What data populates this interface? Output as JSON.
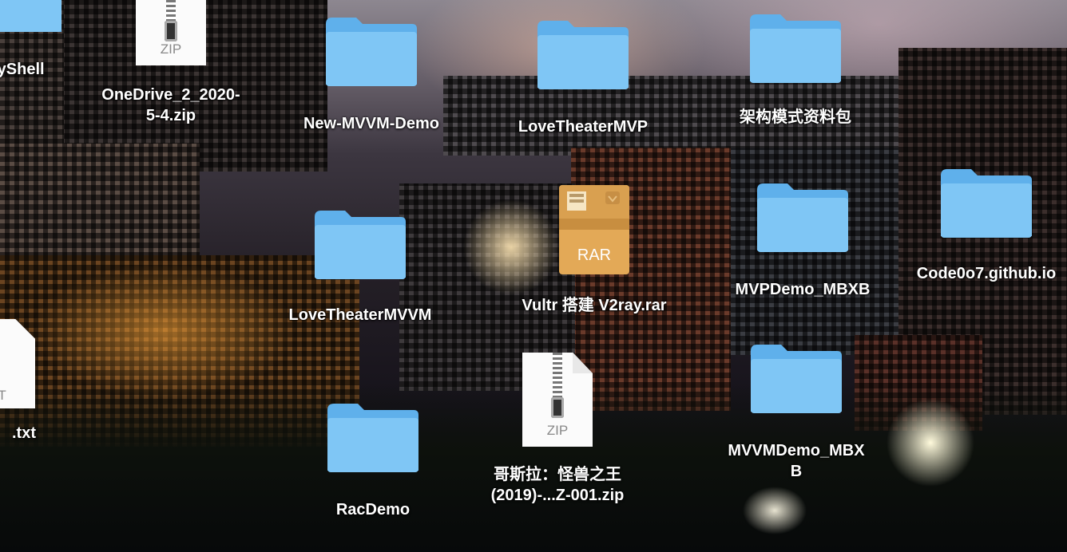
{
  "desktop": {
    "items": [
      {
        "label": "oyShell",
        "type": "folder"
      },
      {
        "label": "OneDrive_2_2020-\n5-4.zip",
        "type": "zip",
        "badge": "ZIP"
      },
      {
        "label": "New-MVVM-Demo",
        "type": "folder"
      },
      {
        "label": "LoveTheaterMVP",
        "type": "folder"
      },
      {
        "label": "架构模式资料包",
        "type": "folder"
      },
      {
        "label": "LoveTheaterMVVM",
        "type": "folder"
      },
      {
        "label": "Vultr 搭建 V2ray.rar",
        "type": "rar",
        "badge": "RAR"
      },
      {
        "label": "MVPDemo_MBXB",
        "type": "folder"
      },
      {
        "label": "Code0o7.github.io",
        "type": "folder"
      },
      {
        "label": ".txt",
        "type": "text",
        "badge": "XT"
      },
      {
        "label": "RacDemo",
        "type": "folder"
      },
      {
        "label": "哥斯拉：怪兽之王\n(2019)-...Z-001.zip",
        "type": "zip",
        "badge": "ZIP"
      },
      {
        "label": "MVVMDemo_MBX\nB",
        "type": "folder"
      }
    ]
  },
  "colors": {
    "folder_front": "#7fc6f5",
    "folder_back": "#5fb0eb",
    "rar_box": "#e3a957",
    "label": "#ffffff"
  }
}
